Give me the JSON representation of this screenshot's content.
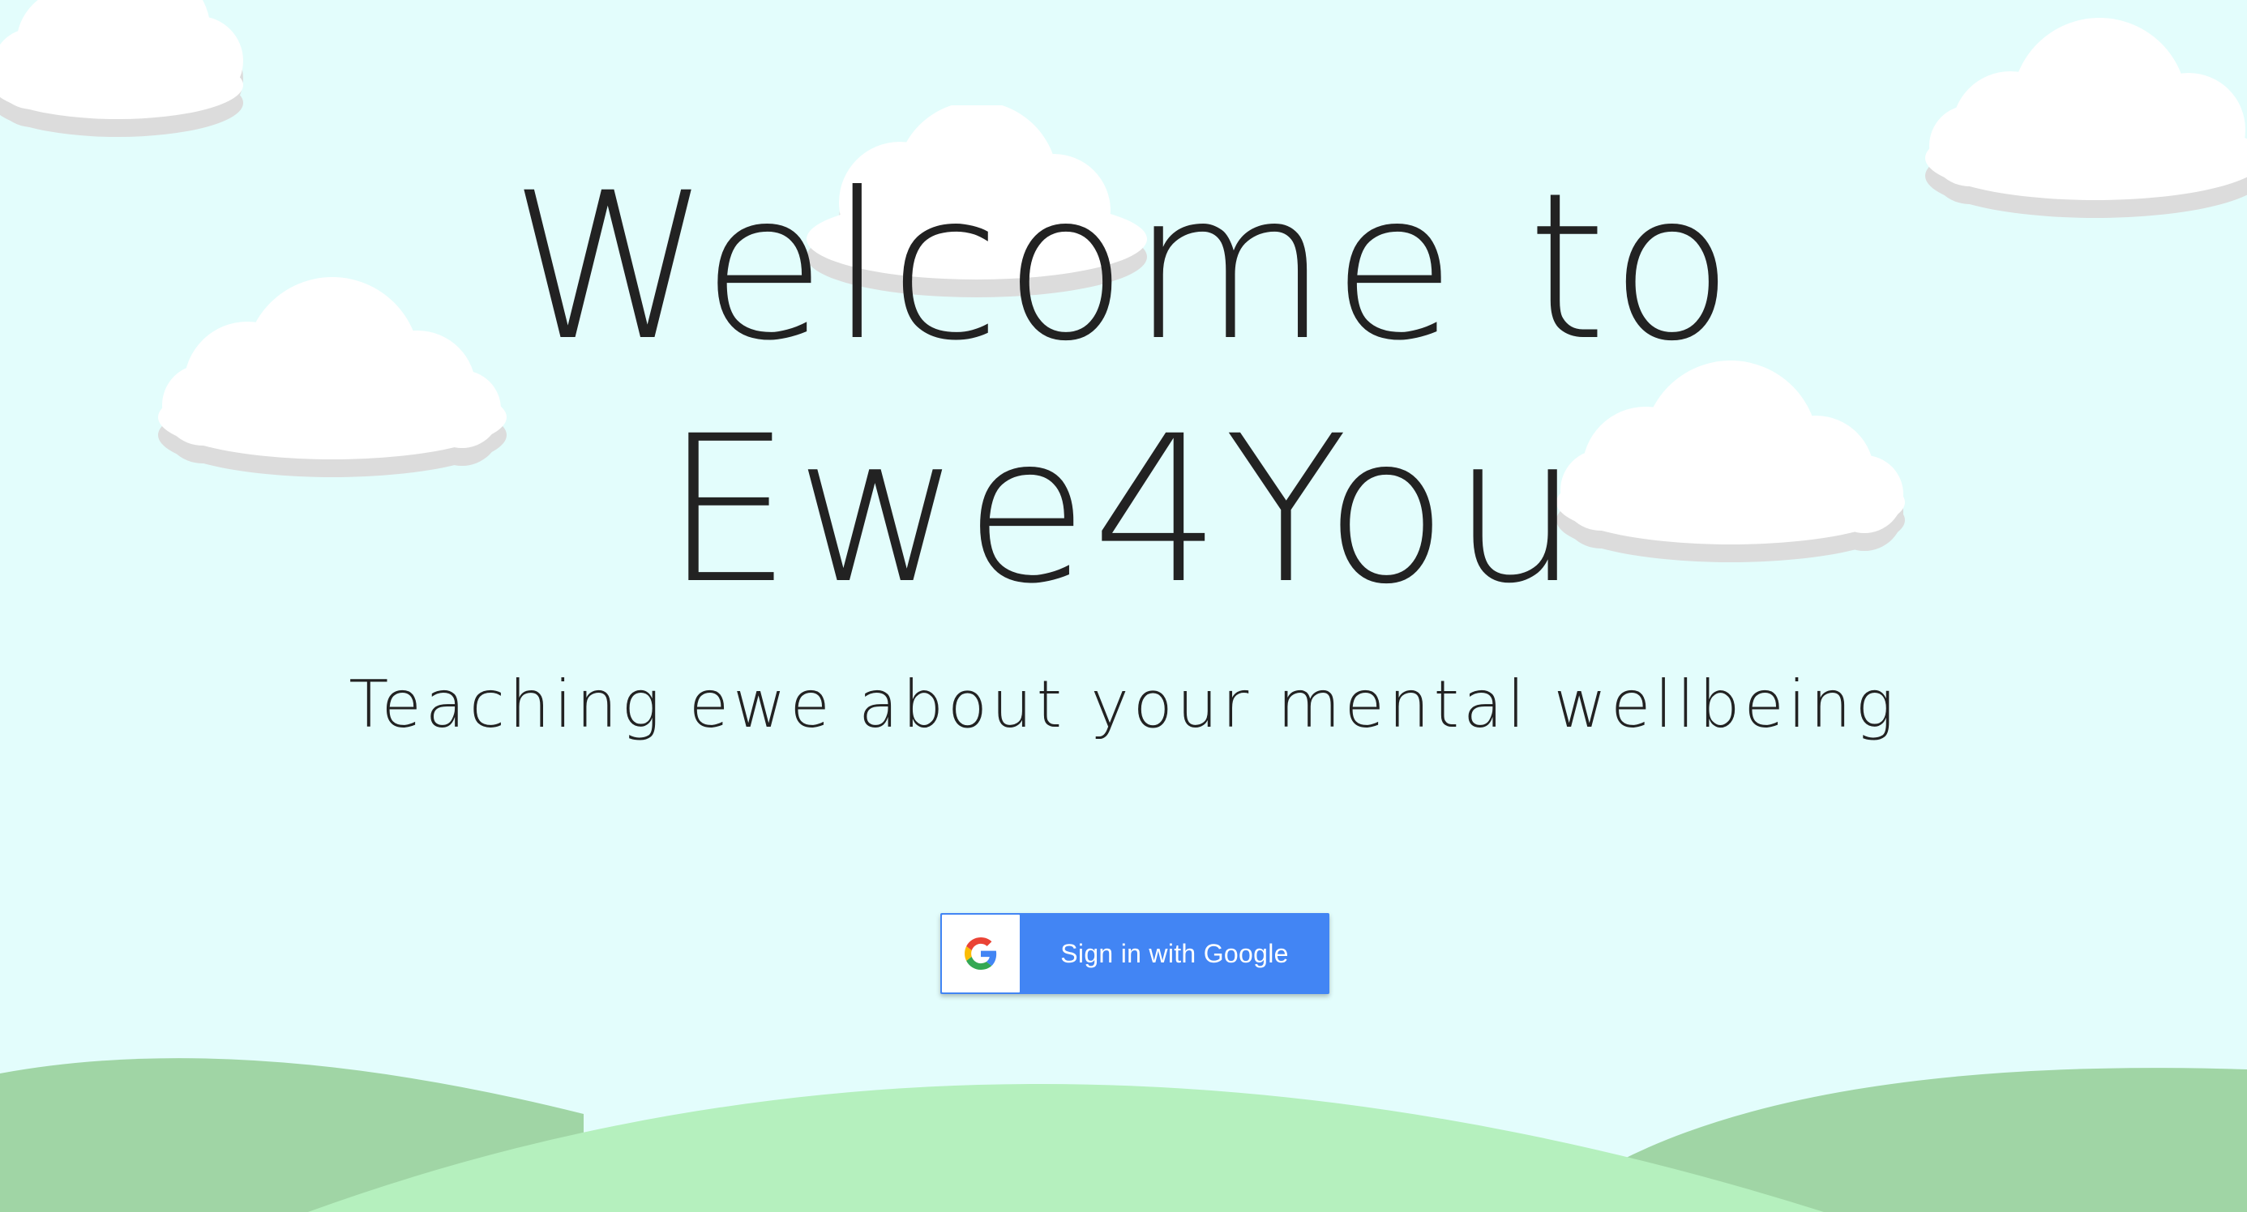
{
  "hero": {
    "title_line1": "Welcome to",
    "title_line2": "Ewe4You",
    "subtitle": "Teaching ewe about your mental wellbeing"
  },
  "auth": {
    "google_button_label": "Sign in with Google"
  },
  "colors": {
    "sky": "#e3fdfc",
    "hill_dark": "#a0d5a5",
    "hill_light": "#b5f0be",
    "cloud": "#ffffff",
    "cloud_shadow": "#dddddd",
    "text": "#222222",
    "google_blue": "#4285f4"
  },
  "icons": {
    "google": "google-g-icon"
  }
}
